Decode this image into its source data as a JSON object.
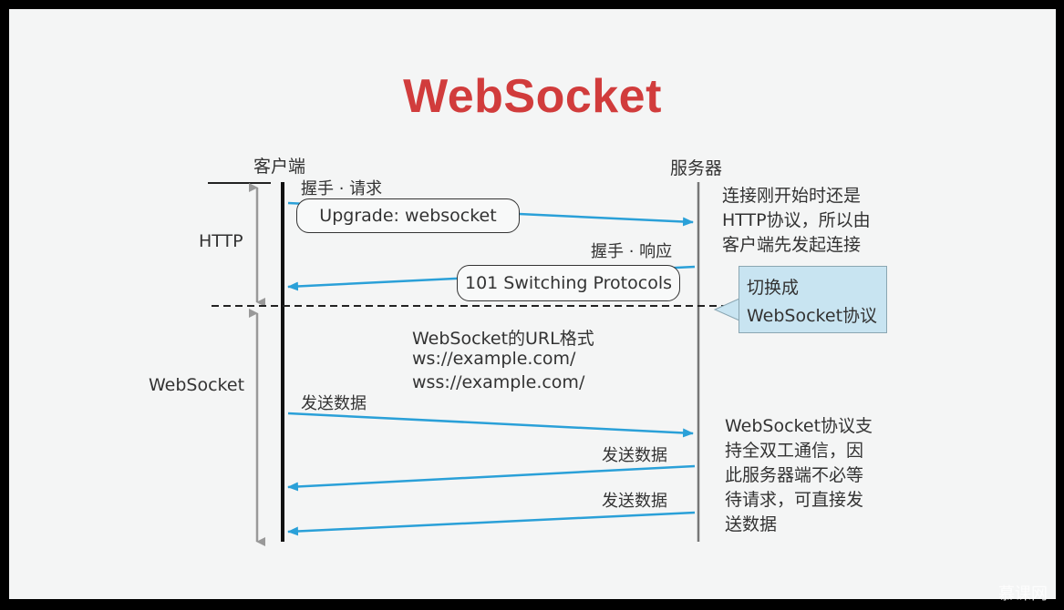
{
  "title": "WebSocket",
  "client_label": "客户端",
  "server_label": "服务器",
  "phases": {
    "http": "HTTP",
    "websocket": "WebSocket"
  },
  "messages": [
    {
      "caption": "握手 · 请求",
      "bubble": "Upgrade: websocket",
      "direction": "client-to-server"
    },
    {
      "caption": "握手 · 响应",
      "bubble": "101 Switching Protocols",
      "direction": "server-to-client"
    },
    {
      "caption": "发送数据",
      "direction": "client-to-server"
    },
    {
      "caption": "发送数据",
      "direction": "server-to-client"
    },
    {
      "caption": "发送数据",
      "direction": "server-to-client"
    }
  ],
  "url_format": {
    "heading": "WebSocket的URL格式",
    "ws": "ws://example.com/",
    "wss": "wss://example.com/"
  },
  "notes": {
    "http_start": [
      "连接刚开始时还是",
      "HTTP协议，所以由",
      "客户端先发起连接"
    ],
    "switch_callout": [
      "切换成",
      "WebSocket协议"
    ],
    "full_duplex": [
      "WebSocket协议支",
      "持全双工通信，因",
      "此服务器端不必等",
      "待请求，可直接发",
      "送数据"
    ]
  },
  "watermark": "慕课网",
  "colors": {
    "title": "#d13c3c",
    "arrow": "#2aa0d8",
    "callout": "#c8e4f1",
    "lifeline": "#111111"
  }
}
